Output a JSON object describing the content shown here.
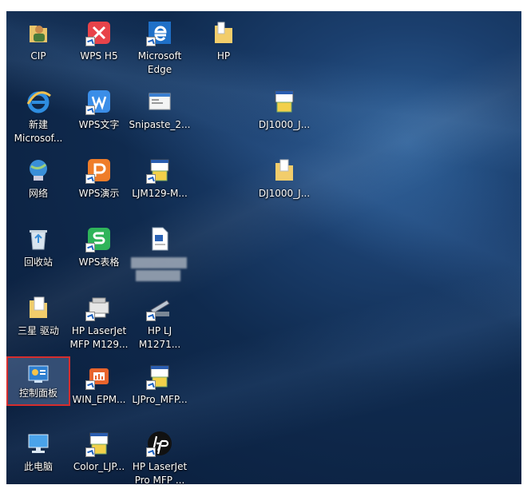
{
  "desktop": {
    "icons": [
      {
        "label": "CIP"
      },
      {
        "label": "WPS H5"
      },
      {
        "label": "Microsoft\nEdge"
      },
      {
        "label": "HP"
      },
      {
        "label": "新建\nMicrosof..."
      },
      {
        "label": "WPS文字"
      },
      {
        "label": "Snipaste_2..."
      },
      {
        "label": "DJ1000_J..."
      },
      {
        "label": "网络"
      },
      {
        "label": "WPS演示"
      },
      {
        "label": "LJM129-M..."
      },
      {
        "label": "DJ1000_J..."
      },
      {
        "label": "回收站"
      },
      {
        "label": "WPS表格"
      },
      {
        "label": "三星 驱动"
      },
      {
        "label": "HP LaserJet\nMFP M129..."
      },
      {
        "label": "HP LJ\nM1271..."
      },
      {
        "label": "控制面板"
      },
      {
        "label": "WIN_EPM..."
      },
      {
        "label": "LJPro_MFP..."
      },
      {
        "label": "此电脑"
      },
      {
        "label": "Color_LJP..."
      },
      {
        "label": "HP LaserJet\nPro MFP ..."
      }
    ]
  },
  "colors": {
    "desktop_background": "#0f2a4e",
    "selection_border": "#d62d2d"
  }
}
